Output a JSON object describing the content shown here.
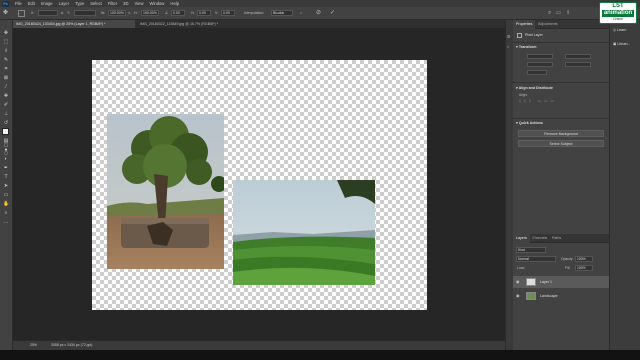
{
  "app": {
    "logo_text": "Ps"
  },
  "menu": [
    "File",
    "Edit",
    "Image",
    "Layer",
    "Type",
    "Select",
    "Filter",
    "3D",
    "View",
    "Window",
    "Help"
  ],
  "options": {
    "w_value": "2850.40 px",
    "h_value": "3420.40 px",
    "w_pct": "100.00%",
    "h_pct": "100.00%",
    "angle": "0.00",
    "h_skew": "0.00",
    "v_skew": "0.00",
    "interp_label": "Interpolation:",
    "interp_value": "Bicubic"
  },
  "tabs": [
    {
      "label": "IMG_20180424_103404.jpg @ 25% (Layer 1, RGB/8*) *",
      "active": true
    },
    {
      "label": "IMG_20180322_115849.jpg @ 16.7% (RGB/8*) *",
      "active": false
    }
  ],
  "status": {
    "zoom": "25%",
    "doc": "3058 px x 2434 px (72 ppi)"
  },
  "properties": {
    "tabs": [
      "Properties",
      "Adjustments"
    ],
    "kind": "Pixel Layer",
    "transform_title": "Transform",
    "align_title": "Align and Distribute",
    "align_sub": "Align:",
    "quick_title": "Quick Actions",
    "remove_bg": "Remove Background",
    "select_subject": "Select Subject"
  },
  "layers": {
    "tabs": [
      "Layers",
      "Channels",
      "Paths"
    ],
    "kind": "Kind",
    "blend": "Normal",
    "opacity_label": "Opacity:",
    "opacity": "100%",
    "lock_label": "Lock:",
    "fill_label": "Fill:",
    "fill": "100%",
    "items": [
      {
        "name": "Layer 1",
        "selected": true
      },
      {
        "name": "Landscape",
        "selected": false
      }
    ]
  },
  "right_dock": [
    "Learn",
    "Librari..."
  ],
  "watermark": {
    "line1": "LST",
    "line2": "animation",
    "line3": "Online"
  },
  "colors": {
    "accent": "#39a0ff",
    "logo_green": "#0b7a3c",
    "canvas_bg": "#262626"
  }
}
